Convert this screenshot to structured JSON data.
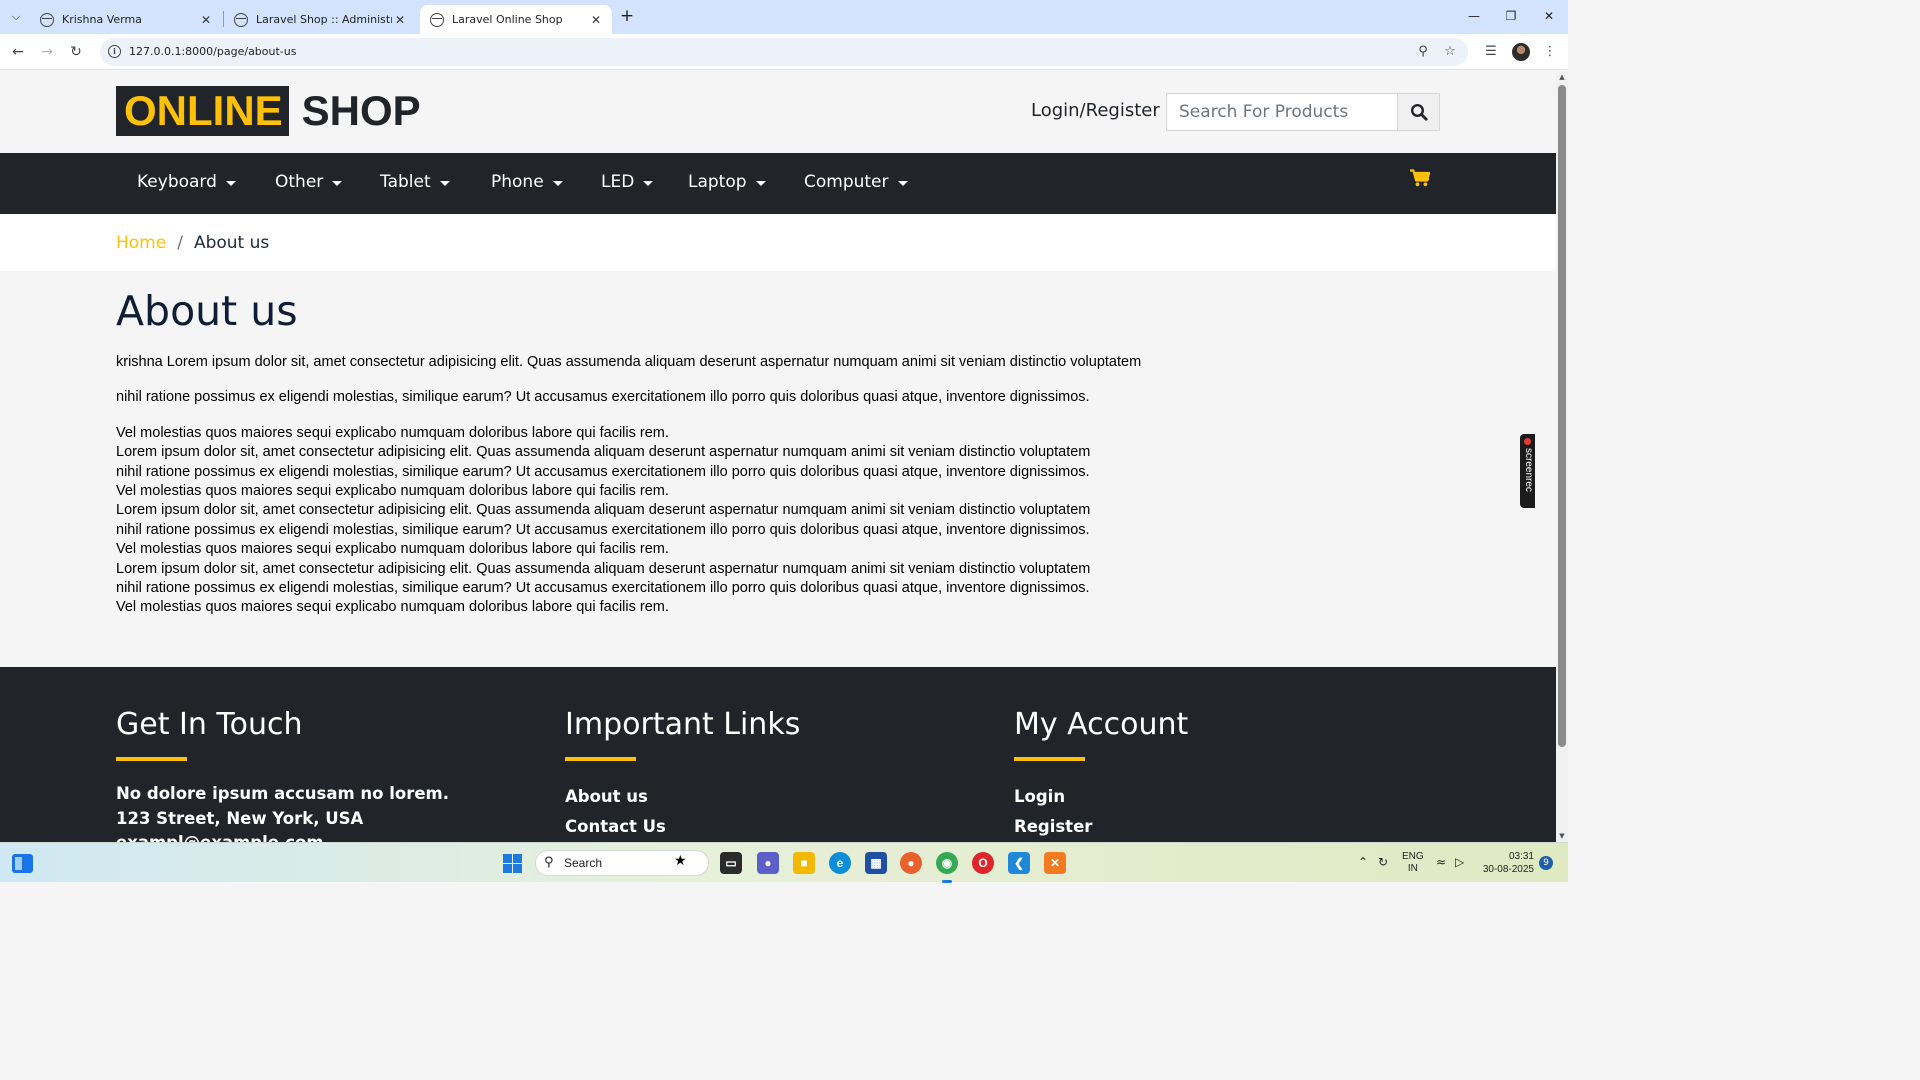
{
  "browser": {
    "tabs": [
      {
        "title": "Krishna Verma"
      },
      {
        "title": "Laravel Shop :: Administrative P"
      },
      {
        "title": "Laravel Online Shop"
      }
    ],
    "url": "127.0.0.1:8000/page/about-us"
  },
  "header": {
    "logo_highlight": "ONLINE",
    "logo_rest": "SHOP",
    "login_label": "Login/Register",
    "search_placeholder": "Search For Products"
  },
  "nav": {
    "items": [
      "Keyboard",
      "Other",
      "Tablet",
      "Phone",
      "LED",
      "Laptop",
      "Computer"
    ]
  },
  "breadcrumb": {
    "home": "Home",
    "separator": "/",
    "current": "About us"
  },
  "page": {
    "title": "About us",
    "paragraph_1": "krishna Lorem ipsum dolor sit, amet consectetur adipisicing elit. Quas assumenda aliquam deserunt aspernatur numquam animi sit veniam distinctio voluptatem",
    "paragraph_2": "nihil ratione possimus ex eligendi molestias, similique earum? Ut accusamus exercitationem illo porro quis doloribus quasi atque, inventore dignissimos.",
    "paragraph_3": " Vel molestias quos maiores sequi explicabo numquam doloribus labore qui facilis rem.\nLorem ipsum dolor sit, amet consectetur adipisicing elit. Quas assumenda aliquam deserunt aspernatur numquam animi sit veniam distinctio voluptatem\nnihil ratione possimus ex eligendi molestias, similique earum? Ut accusamus exercitationem illo porro quis doloribus quasi atque, inventore dignissimos.\n Vel molestias quos maiores sequi explicabo numquam doloribus labore qui facilis rem.\nLorem ipsum dolor sit, amet consectetur adipisicing elit. Quas assumenda aliquam deserunt aspernatur numquam animi sit veniam distinctio voluptatem\nnihil ratione possimus ex eligendi molestias, similique earum? Ut accusamus exercitationem illo porro quis doloribus quasi atque, inventore dignissimos.\n Vel molestias quos maiores sequi explicabo numquam doloribus labore qui facilis rem.\nLorem ipsum dolor sit, amet consectetur adipisicing elit. Quas assumenda aliquam deserunt aspernatur numquam animi sit veniam distinctio voluptatem\nnihil ratione possimus ex eligendi molestias, similique earum? Ut accusamus exercitationem illo porro quis doloribus quasi atque, inventore dignissimos.\n Vel molestias quos maiores sequi explicabo numquam doloribus labore qui facilis rem."
  },
  "footer": {
    "touch": {
      "heading": "Get In Touch",
      "lines": [
        "No dolore ipsum accusam no lorem.",
        "123 Street, New York, USA",
        "exampl@example.com"
      ]
    },
    "links": {
      "heading": "Important Links",
      "items": [
        "About us",
        "Contact Us"
      ]
    },
    "account": {
      "heading": "My Account",
      "items": [
        "Login",
        "Register"
      ]
    }
  },
  "widget": {
    "label": "screenrec"
  },
  "taskbar": {
    "search_label": "Search",
    "lang_line1": "ENG",
    "lang_line2": "IN",
    "time": "03:31",
    "date": "30-08-2025",
    "notification_count": "9"
  },
  "colors": {
    "accent": "#ffc107",
    "dark": "#212529",
    "title": "#0f1e36"
  }
}
